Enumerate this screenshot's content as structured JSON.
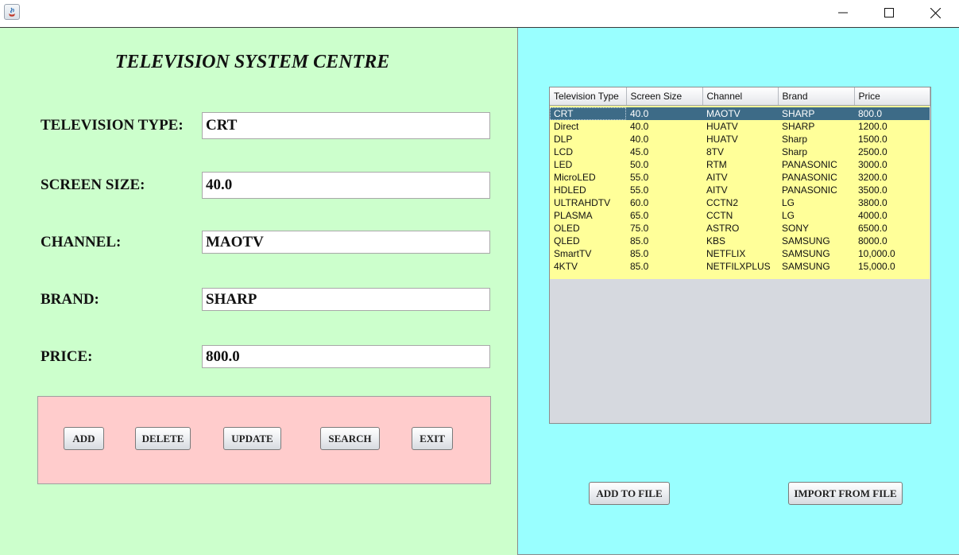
{
  "window": {
    "title": "",
    "controls": {
      "minimize": "minimize-icon",
      "maximize": "maximize-icon",
      "close": "close-icon"
    }
  },
  "form": {
    "title": "TELEVISION SYSTEM CENTRE",
    "fields": {
      "type": {
        "label": "TELEVISION TYPE:",
        "value": "CRT"
      },
      "size": {
        "label": "SCREEN SIZE:",
        "value": "40.0"
      },
      "channel": {
        "label": "CHANNEL:",
        "value": "MAOTV"
      },
      "brand": {
        "label": "BRAND:",
        "value": "SHARP"
      },
      "price": {
        "label": "PRICE:",
        "value": "800.0"
      }
    },
    "buttons": {
      "add": "ADD",
      "delete": "DELETE",
      "update": "UPDATE",
      "search": "SEARCH",
      "exit": "EXIT"
    }
  },
  "table": {
    "columns": [
      "Television Type",
      "Screen Size",
      "Channel",
      "Brand",
      "Price"
    ],
    "selected_row": 0,
    "rows": [
      [
        "CRT",
        "40.0",
        "MAOTV",
        "SHARP",
        "800.0"
      ],
      [
        "Direct",
        "40.0",
        "HUATV",
        "SHARP",
        "1200.0"
      ],
      [
        "DLP",
        "40.0",
        "HUATV",
        "Sharp",
        "1500.0"
      ],
      [
        "LCD",
        "45.0",
        "8TV",
        "Sharp",
        "2500.0"
      ],
      [
        "LED",
        "50.0",
        "RTM",
        "PANASONIC",
        "3000.0"
      ],
      [
        "MicroLED",
        "55.0",
        "AITV",
        "PANASONIC",
        "3200.0"
      ],
      [
        "HDLED",
        "55.0",
        "AITV",
        "PANASONIC",
        "3500.0"
      ],
      [
        "ULTRAHDTV",
        "60.0",
        "CCTN2",
        "LG",
        "3800.0"
      ],
      [
        "PLASMA",
        "65.0",
        "CCTN",
        "LG",
        "4000.0"
      ],
      [
        "OLED",
        "75.0",
        "ASTRO",
        "SONY",
        "6500.0"
      ],
      [
        "QLED",
        "85.0",
        "KBS",
        "SAMSUNG",
        "8000.0"
      ],
      [
        "SmartTV",
        "85.0",
        "NETFLIX",
        "SAMSUNG",
        "10,000.0"
      ],
      [
        "4KTV",
        "85.0",
        "NETFILXPLUS",
        "SAMSUNG",
        "15,000.0"
      ]
    ]
  },
  "file_buttons": {
    "add_to_file": "ADD TO FILE",
    "import_from_file": "IMPORT FROM FILE"
  },
  "colors": {
    "left_panel": "#ccffcc",
    "right_panel": "#99ffff",
    "button_panel": "#ffcccc",
    "table_rows": "#ffff99",
    "selection": "#3d6b87"
  }
}
